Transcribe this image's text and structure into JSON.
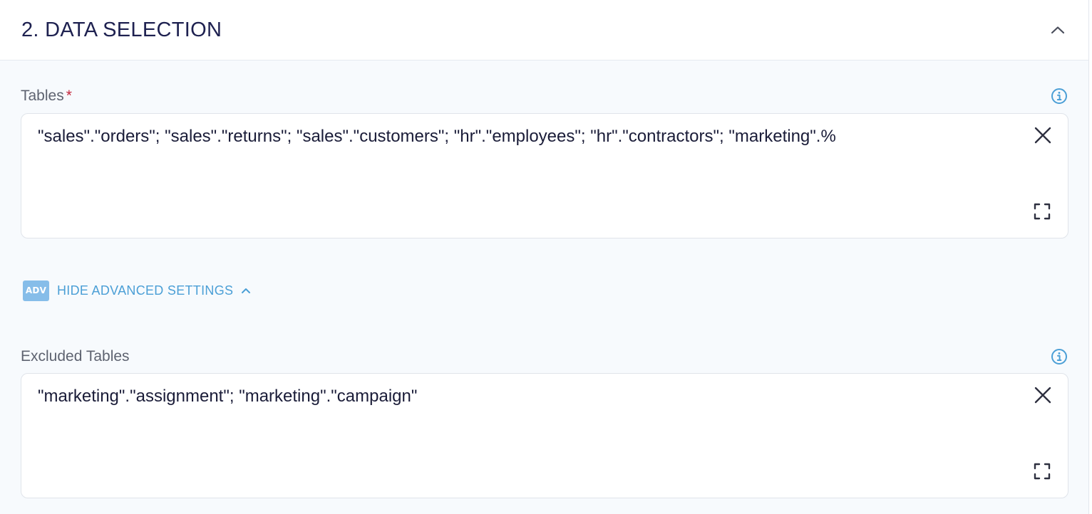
{
  "section": {
    "title": "2. DATA SELECTION"
  },
  "tables": {
    "label": "Tables",
    "required_marker": "*",
    "value": "\"sales\".\"orders\"; \"sales\".\"returns\"; \"sales\".\"customers\"; \"hr\".\"employees\"; \"hr\".\"contractors\"; \"marketing\".%"
  },
  "advanced": {
    "badge": "ADV",
    "label": "HIDE ADVANCED SETTINGS"
  },
  "excluded_tables": {
    "label": "Excluded Tables",
    "value": "\"marketing\".\"assignment\"; \"marketing\".\"campaign\""
  },
  "colors": {
    "title": "#1e2150",
    "accent": "#4b9fd6",
    "badge": "#86bde9",
    "required": "#c5283d",
    "text": "#1a1c38"
  },
  "icons": {
    "collapse": "chevron-up-icon",
    "info": "info-icon",
    "clear": "close-icon",
    "expand": "fullscreen-icon",
    "advanced_chevron": "chevron-up-icon"
  }
}
